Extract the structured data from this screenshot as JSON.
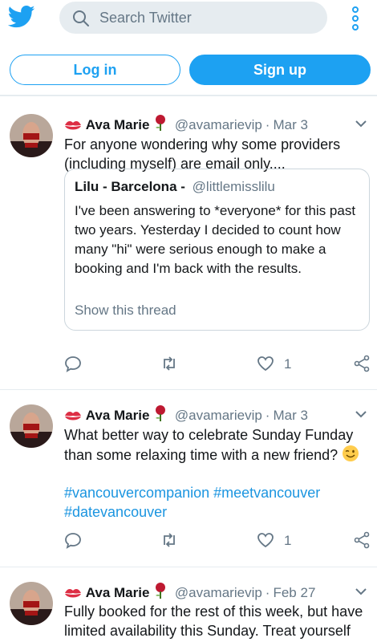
{
  "header": {
    "search_placeholder": "Search Twitter",
    "login_label": "Log in",
    "signup_label": "Sign up"
  },
  "colors": {
    "brand_blue": "#1da1f2",
    "hashtag_blue": "#1b95e0",
    "secondary_text": "#657786",
    "border": "#e6ecf0"
  },
  "tweets": [
    {
      "name": "Ava Marie",
      "handle": "@avamarievip",
      "separator": "·",
      "date": "Mar 3",
      "text_line1": "For anyone wondering why some providers",
      "text_line2": "(including myself) are email only....",
      "quote": {
        "name": "Lilu - Barcelona -",
        "handle": "@littlemisslilu",
        "text": "I've been answering to *everyone* for this past two years. Yesterday I decided to count how many \"hi\" were serious enough to make a booking and I'm back with the results.",
        "show_thread": "Show this thread"
      },
      "like_count": "1"
    },
    {
      "name": "Ava Marie",
      "handle": "@avamarievip",
      "separator": "·",
      "date": "Mar 3",
      "text_line1": "What better way to celebrate Sunday Funday",
      "text_line2": "than some relaxing time with a new friend?",
      "hashtags_line1": "#vancouvercompanion #meetvancouver",
      "hashtags_line2": "#datevancouver",
      "like_count": "1"
    },
    {
      "name": "Ava Marie",
      "handle": "@avamarievip",
      "separator": "·",
      "date": "Feb 27",
      "text_line1": "Fully booked for the rest of this week, but have",
      "text_line2": "limited availability this Sunday. Treat yourself"
    }
  ]
}
